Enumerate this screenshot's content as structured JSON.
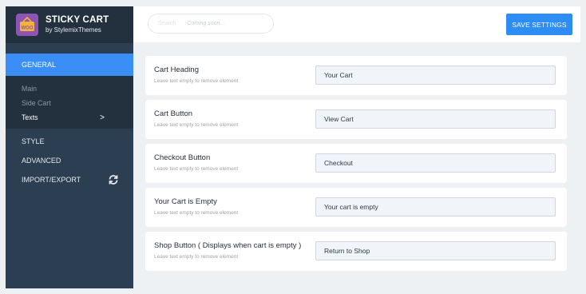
{
  "brand": {
    "title": "STICKY CART",
    "subtitle": "by StylemixThemes",
    "logo_text": "WOO"
  },
  "search": {
    "placeholder": "Search",
    "note": "Coming soon..."
  },
  "toolbar": {
    "save_label": "SAVE SETTINGS"
  },
  "sidebar": {
    "general_label": "GENERAL",
    "subitems": [
      {
        "label": "Main"
      },
      {
        "label": "Side Cart"
      },
      {
        "label": "Texts",
        "active": true,
        "indicator": ">"
      }
    ],
    "items": [
      {
        "label": "STYLE"
      },
      {
        "label": "ADVANCED"
      },
      {
        "label": "IMPORT/EXPORT",
        "icon": "refresh-icon"
      }
    ]
  },
  "settings": [
    {
      "title": "Cart Heading",
      "hint": "Leave text empty to remove element",
      "value": "Your Cart"
    },
    {
      "title": "Cart Button",
      "hint": "Leave text empty to remove element",
      "value": "View Cart"
    },
    {
      "title": "Checkout Button",
      "hint": "Leave text empty to remove element",
      "value": "Checkout"
    },
    {
      "title": "Your Cart is Empty",
      "hint": "Leave text empty to remove element",
      "value": "Your cart is empty"
    },
    {
      "title": "Shop Button ( Displays when cart is empty )",
      "hint": "Leave text empty to remove element",
      "value": "Return to Shop"
    }
  ],
  "colors": {
    "accent": "#2e8df5",
    "sidebar": "#2c3e52",
    "sidebar_dark": "#23313f",
    "logo": "#8e54b4"
  }
}
